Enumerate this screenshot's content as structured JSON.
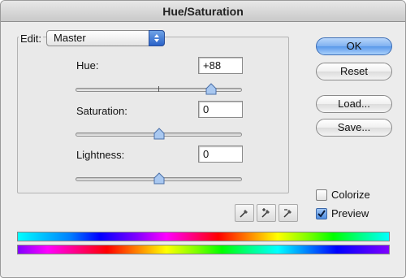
{
  "window": {
    "title": "Hue/Saturation"
  },
  "edit": {
    "label": "Edit:",
    "value": "Master"
  },
  "hue": {
    "label": "Hue:",
    "value": "+88",
    "slider_value": 88,
    "range": [
      -180,
      180
    ]
  },
  "saturation": {
    "label": "Saturation:",
    "value": "0",
    "slider_value": 0,
    "range": [
      -100,
      100
    ]
  },
  "lightness": {
    "label": "Lightness:",
    "value": "0",
    "slider_value": 0,
    "range": [
      -100,
      100
    ]
  },
  "buttons": {
    "ok": "OK",
    "reset": "Reset",
    "load": "Load...",
    "save": "Save..."
  },
  "options": {
    "colorize": "Colorize",
    "colorize_checked": false,
    "preview": "Preview",
    "preview_checked": true
  },
  "icons": {
    "eyedropper": "eyedropper-icon",
    "eyedropper_plus": "eyedropper-plus-icon",
    "eyedropper_minus": "eyedropper-minus-icon",
    "checkmark": "checkmark-icon"
  },
  "colors": {
    "accent": "#5a98ea",
    "window_bg": "#ececec"
  }
}
